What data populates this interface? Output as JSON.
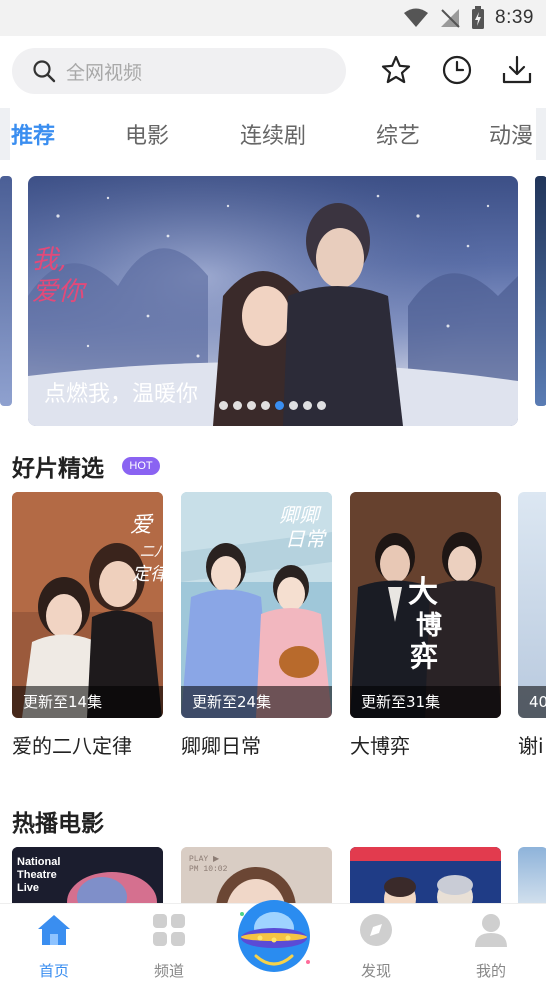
{
  "status_bar": {
    "time": "8:39"
  },
  "search": {
    "placeholder": "全网视频"
  },
  "header_icons": [
    "star-icon",
    "history-clock-icon",
    "download-icon"
  ],
  "tabs": [
    {
      "label": "推荐",
      "active": true
    },
    {
      "label": "电影",
      "active": false
    },
    {
      "label": "连续剧",
      "active": false
    },
    {
      "label": "综艺",
      "active": false
    },
    {
      "label": "动漫",
      "active": false
    }
  ],
  "banner": {
    "caption": "点燃我，温暖你",
    "poster_text": "我,\n爱你",
    "dot_count": 8,
    "active_dot": 5
  },
  "featured": {
    "title": "好片精选",
    "badge": "HOT",
    "items": [
      {
        "title": "爱的二八定律",
        "update": "更新至14集"
      },
      {
        "title": "卿卿日常",
        "update": "更新至24集"
      },
      {
        "title": "大博弈",
        "update": "更新至31集"
      },
      {
        "title": "谢i",
        "update": "40"
      }
    ],
    "poster_texts": [
      "爱的二八定律",
      "卿卿日常",
      "大博弈"
    ]
  },
  "hot_movies": {
    "title": "热播电影",
    "poster_texts": [
      "National Theatre Live"
    ]
  },
  "bottom_nav": [
    {
      "label": "首页",
      "icon": "home-icon",
      "active": true
    },
    {
      "label": "频道",
      "icon": "grid-icon",
      "active": false
    },
    {
      "label": "",
      "icon": "ufo-icon",
      "active": false
    },
    {
      "label": "发现",
      "icon": "compass-icon",
      "active": false
    },
    {
      "label": "我的",
      "icon": "user-icon",
      "active": false
    }
  ],
  "colors": {
    "accent": "#3a8ef0",
    "hot_badge": "#8a63f2",
    "search_bg": "#f0f0f2"
  }
}
